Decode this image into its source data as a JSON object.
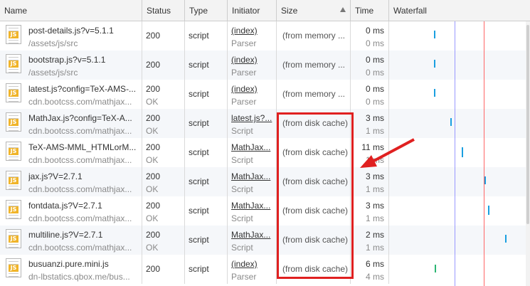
{
  "columns": [
    "Name",
    "Status",
    "Type",
    "Initiator",
    "Size",
    "Time",
    "Waterfall"
  ],
  "sorted_column": "Size",
  "rows": [
    {
      "name": "post-details.js?v=5.1.1",
      "path": "/assets/js/src",
      "status": "200",
      "status_text": "",
      "type": "script",
      "initiator": "(index)",
      "initiator_type": "Parser",
      "size": "(from memory ...",
      "time": "0 ms",
      "latency": "0 ms"
    },
    {
      "name": "bootstrap.js?v=5.1.1",
      "path": "/assets/js/src",
      "status": "200",
      "status_text": "",
      "type": "script",
      "initiator": "(index)",
      "initiator_type": "Parser",
      "size": "(from memory ...",
      "time": "0 ms",
      "latency": "0 ms"
    },
    {
      "name": "latest.js?config=TeX-AMS-...",
      "path": "cdn.bootcss.com/mathjax...",
      "status": "200",
      "status_text": "OK",
      "type": "script",
      "initiator": "(index)",
      "initiator_type": "Parser",
      "size": "(from memory ...",
      "time": "0 ms",
      "latency": "0 ms"
    },
    {
      "name": "MathJax.js?config=TeX-A...",
      "path": "cdn.bootcss.com/mathjax...",
      "status": "200",
      "status_text": "OK",
      "type": "script",
      "initiator": "latest.js?...",
      "initiator_type": "Script",
      "size": "(from disk cache)",
      "time": "3 ms",
      "latency": "1 ms"
    },
    {
      "name": "TeX-AMS-MML_HTMLorM...",
      "path": "cdn.bootcss.com/mathjax...",
      "status": "200",
      "status_text": "OK",
      "type": "script",
      "initiator": "MathJax...",
      "initiator_type": "Script",
      "size": "(from disk cache)",
      "time": "11 ms",
      "latency": "1 ms"
    },
    {
      "name": "jax.js?V=2.7.1",
      "path": "cdn.bootcss.com/mathjax...",
      "status": "200",
      "status_text": "OK",
      "type": "script",
      "initiator": "MathJax...",
      "initiator_type": "Script",
      "size": "(from disk cache)",
      "time": "3 ms",
      "latency": "1 ms"
    },
    {
      "name": "fontdata.js?V=2.7.1",
      "path": "cdn.bootcss.com/mathjax...",
      "status": "200",
      "status_text": "OK",
      "type": "script",
      "initiator": "MathJax...",
      "initiator_type": "Script",
      "size": "(from disk cache)",
      "time": "3 ms",
      "latency": "1 ms"
    },
    {
      "name": "multiline.js?V=2.7.1",
      "path": "cdn.bootcss.com/mathjax...",
      "status": "200",
      "status_text": "OK",
      "type": "script",
      "initiator": "MathJax...",
      "initiator_type": "Script",
      "size": "(from disk cache)",
      "time": "2 ms",
      "latency": "1 ms"
    },
    {
      "name": "busuanzi.pure.mini.js",
      "path": "dn-lbstatics.qbox.me/bus...",
      "status": "200",
      "status_text": "",
      "type": "script",
      "initiator": "(index)",
      "initiator_type": "Parser",
      "size": "(from disk cache)",
      "time": "6 ms",
      "latency": "4 ms"
    }
  ],
  "icon": {
    "file": "js-file-icon",
    "label": "JS"
  },
  "colors": {
    "highlight": "#e02020",
    "bar": "#1a9fe0",
    "bar_green": "#2bb673",
    "dom_line": "#9999ff",
    "load_line": "#ff6666"
  }
}
